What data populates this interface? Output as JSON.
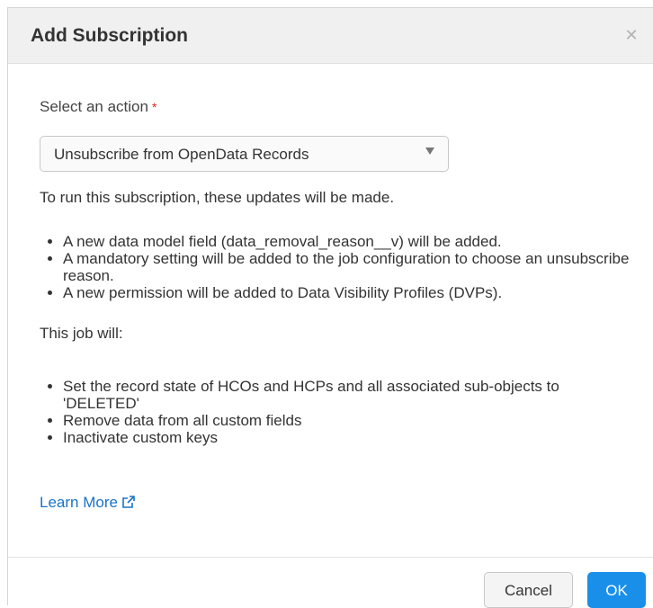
{
  "dialog": {
    "title": "Add Subscription",
    "close_icon": "close-icon"
  },
  "action": {
    "label": "Select an action",
    "required_marker": "*",
    "selected": "Unsubscribe from OpenData Records"
  },
  "intro": "To run this subscription, these updates will be made.",
  "updates": [
    "A new data model field (data_removal_reason__v) will be added.",
    "A mandatory setting will be added to the job configuration to choose an unsubscribe reason.",
    "A new permission will be added to Data Visibility Profiles (DVPs)."
  ],
  "job_label": "This job will:",
  "job_items": [
    "Set the record state of HCOs and HCPs and all associated sub-objects to 'DELETED'",
    "Remove data from all custom fields",
    "Inactivate custom keys"
  ],
  "learn_more": {
    "label": "Learn More",
    "icon": "external-link-icon",
    "color": "#1a73c8"
  },
  "footer": {
    "cancel_label": "Cancel",
    "ok_label": "OK",
    "ok_color": "#1a8fea"
  }
}
